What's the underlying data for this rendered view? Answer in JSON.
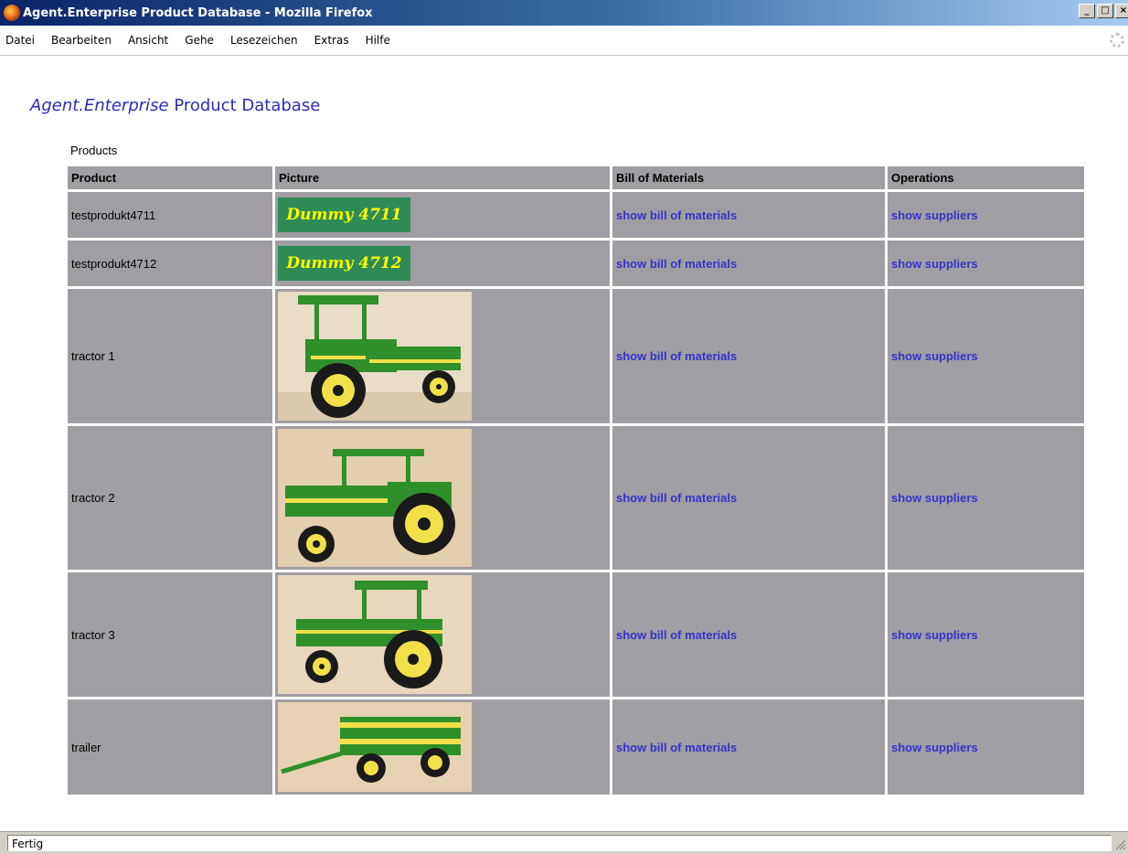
{
  "window": {
    "title": "Agent.Enterprise Product Database - Mozilla Firefox",
    "controls": {
      "minimize": "_",
      "maximize": "□",
      "close": "×"
    }
  },
  "menu": [
    "Datei",
    "Bearbeiten",
    "Ansicht",
    "Gehe",
    "Lesezeichen",
    "Extras",
    "Hilfe"
  ],
  "page": {
    "title_italic": "Agent.Enterprise",
    "title_rest": " Product Database",
    "section_label": "Products"
  },
  "table": {
    "headers": [
      "Product",
      "Picture",
      "Bill of Materials",
      "Operations"
    ],
    "rows": [
      {
        "product": "testprodukt4711",
        "picture_label": "Dummy 4711",
        "picture_type": "dummy",
        "bom_link": "show bill of materials",
        "ops_link": "show suppliers"
      },
      {
        "product": "testprodukt4712",
        "picture_label": "Dummy 4712",
        "picture_type": "dummy",
        "bom_link": "show bill of materials",
        "ops_link": "show suppliers"
      },
      {
        "product": "tractor 1",
        "picture_type": "tractor-photo",
        "bom_link": "show bill of materials",
        "ops_link": "show suppliers"
      },
      {
        "product": "tractor 2",
        "picture_type": "tractor-photo",
        "bom_link": "show bill of materials",
        "ops_link": "show suppliers"
      },
      {
        "product": "tractor 3",
        "picture_type": "tractor-photo",
        "bom_link": "show bill of materials",
        "ops_link": "show suppliers"
      },
      {
        "product": "trailer",
        "picture_type": "trailer-photo",
        "bom_link": "show bill of materials",
        "ops_link": "show suppliers"
      }
    ]
  },
  "status": {
    "text": "Fertig"
  },
  "colors": {
    "title_blue": "#2d2bb8",
    "link_blue": "#3333cc",
    "cell_gray": "#a09ea3",
    "dummy_green": "#2e8b57",
    "dummy_text_yellow": "#ffff00",
    "model_green": "#2f8f2a",
    "model_yellow": "#f2e04a"
  }
}
